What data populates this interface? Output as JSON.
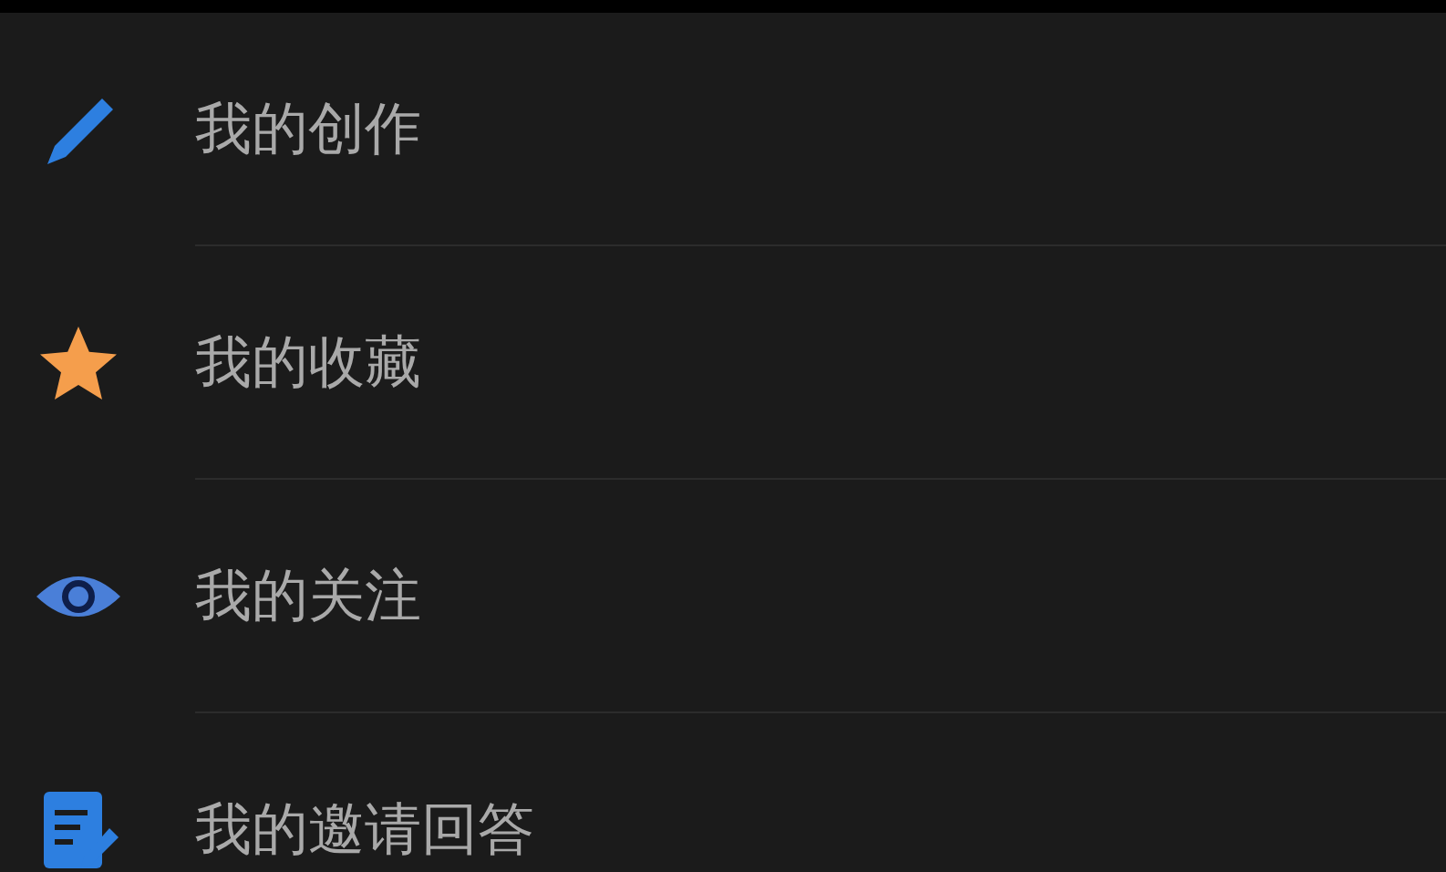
{
  "menu_items": [
    {
      "label": "我的创作"
    },
    {
      "label": "我的收藏"
    },
    {
      "label": "我的关注"
    },
    {
      "label": "我的邀请回答"
    }
  ]
}
